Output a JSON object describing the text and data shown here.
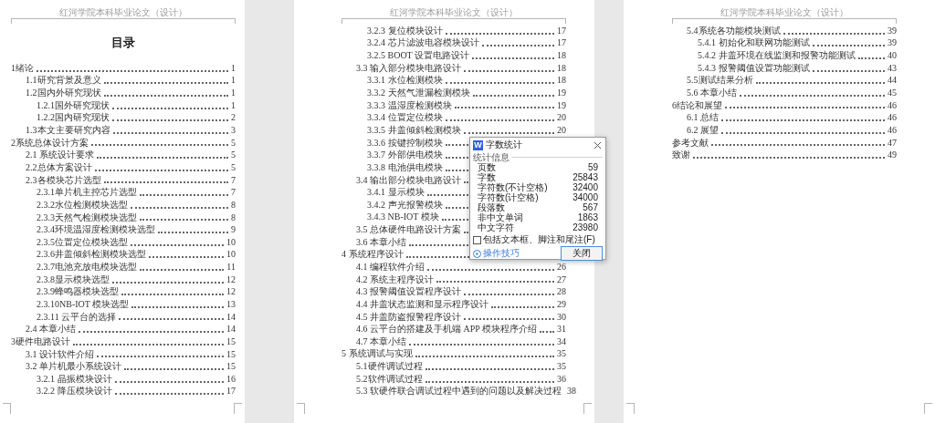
{
  "pages": [
    {
      "header": "红河学院本科毕业论文（设计）",
      "title": "目录",
      "entries": [
        {
          "kind": "chapter",
          "label": "1绪论",
          "page": "1"
        },
        {
          "kind": "section",
          "label": "1.1研究背景及意义",
          "page": "1"
        },
        {
          "kind": "section",
          "label": "1.2国内外研究现状",
          "page": "1"
        },
        {
          "kind": "subsection",
          "label": "1.2.1国外研究现状",
          "page": "1"
        },
        {
          "kind": "subsection",
          "label": "1.2.2国内研究现状",
          "page": "2"
        },
        {
          "kind": "section",
          "label": "1.3本文主要研究内容",
          "page": "3"
        },
        {
          "kind": "chapter",
          "label": "2系统总体设计方案",
          "page": "5"
        },
        {
          "kind": "section",
          "label": "2.1 系统设计要求",
          "page": "5"
        },
        {
          "kind": "section",
          "label": "2.2总体方案设计",
          "page": "5"
        },
        {
          "kind": "section",
          "label": "2.3各模块芯片选型",
          "page": "7"
        },
        {
          "kind": "subsection",
          "label": "2.3.1单片机主控芯片选型",
          "page": "7"
        },
        {
          "kind": "subsection",
          "label": "2.3.2水位检测模块选型",
          "page": "8"
        },
        {
          "kind": "subsection",
          "label": "2.3.3天然气检测模块选型",
          "page": "8"
        },
        {
          "kind": "subsection",
          "label": "2.3.4环境温湿度检测模块选型",
          "page": "9"
        },
        {
          "kind": "subsection",
          "label": "2.3.5位置定位模块选型",
          "page": "10"
        },
        {
          "kind": "subsection",
          "label": "2.3.6井盖倾斜检测模块选型",
          "page": "10"
        },
        {
          "kind": "subsection",
          "label": "2.3.7电池充放电模块选型",
          "page": "11"
        },
        {
          "kind": "subsection",
          "label": "2.3.8显示模块选型",
          "page": "12"
        },
        {
          "kind": "subsection",
          "label": "2.3.9蜂鸣器模块选型",
          "page": "12"
        },
        {
          "kind": "subsection",
          "label": "2.3.10NB-IOT 模块选型",
          "page": "13"
        },
        {
          "kind": "subsection",
          "label": "2.3.11 云平台的选择",
          "page": "14"
        },
        {
          "kind": "section",
          "label": "2.4 本章小结",
          "page": "14"
        },
        {
          "kind": "chapter",
          "label": "3硬件电路设计",
          "page": "15"
        },
        {
          "kind": "section",
          "label": "3.1 设计软件介绍",
          "page": "15"
        },
        {
          "kind": "section",
          "label": "3.2 单片机最小系统设计",
          "page": "15"
        },
        {
          "kind": "subsection",
          "label": "3.2.1 晶振模块设计",
          "page": "16"
        },
        {
          "kind": "subsection",
          "label": "3.2.2 降压模块设计",
          "page": "17"
        }
      ]
    },
    {
      "header": "红河学院本科毕业论文（设计）",
      "entries": [
        {
          "kind": "subsection",
          "label": "3.2.3 复位模块设计",
          "page": "17"
        },
        {
          "kind": "subsection",
          "label": "3.2.4 芯片滤波电容模块设计",
          "page": "17"
        },
        {
          "kind": "subsection",
          "label": "3.2.5 BOOT 设置电路设计",
          "page": "18"
        },
        {
          "kind": "section",
          "label": "3.3 输入部分模块电路设计",
          "page": "18"
        },
        {
          "kind": "subsection",
          "label": "3.3.1 水位检测模块",
          "page": "18"
        },
        {
          "kind": "subsection",
          "label": "3.3.2 天然气泄漏检测模块",
          "page": "19"
        },
        {
          "kind": "subsection",
          "label": "3.3.3 温湿度检测模块",
          "page": "19"
        },
        {
          "kind": "subsection",
          "label": "3.3.4 位置定位模块",
          "page": "20"
        },
        {
          "kind": "subsection",
          "label": "3.3.5 井盖倾斜检测模块",
          "page": "20"
        },
        {
          "kind": "subsection",
          "label": "3.3.6 按键控制模块"
        },
        {
          "kind": "subsection",
          "label": "3.3.7 外部供电模块"
        },
        {
          "kind": "subsection",
          "label": "3.3.8 电池供电模块"
        },
        {
          "kind": "section",
          "label": "3.4 输出部分模块电路设计"
        },
        {
          "kind": "subsection",
          "label": "3.4.1 显示模块"
        },
        {
          "kind": "subsection",
          "label": "3.4.2 声光报警模块"
        },
        {
          "kind": "subsection",
          "label": "3.4.3 NB-IOT 模块"
        },
        {
          "kind": "section",
          "label": "3.5 总体硬件电路设计方案"
        },
        {
          "kind": "section",
          "label": "3.6 本章小结"
        },
        {
          "kind": "chapter",
          "label": "4 系统程序设计"
        },
        {
          "kind": "section",
          "label": "4.1 编程软件介绍",
          "page": "26"
        },
        {
          "kind": "section",
          "label": "4.2 系统主程序设计",
          "page": "27"
        },
        {
          "kind": "section",
          "label": "4.3 报警阈值设置程序设计",
          "page": "28"
        },
        {
          "kind": "section",
          "label": "4.4 井盖状态监测和显示程序设计",
          "page": "29"
        },
        {
          "kind": "section",
          "label": "4.5 井盖防盗报警程序设计",
          "page": "30"
        },
        {
          "kind": "section",
          "label": "4.6 云平台的搭建及手机端 APP 模块程序介绍",
          "page": "31"
        },
        {
          "kind": "section",
          "label": "4.7 本章小结",
          "page": "34"
        },
        {
          "kind": "chapter",
          "label": "5 系统调试与实现",
          "page": "35"
        },
        {
          "kind": "section",
          "label": "5.1硬件调试过程",
          "page": "35"
        },
        {
          "kind": "section",
          "label": "5.2软件调试过程",
          "page": "36"
        },
        {
          "kind": "section",
          "label": "5.3 软硬件联合调试过程中遇到的问题以及解决过程",
          "page": "38"
        }
      ]
    },
    {
      "header": "红河学院本科毕业论文（设计）",
      "entries": [
        {
          "kind": "section",
          "label": "5.4系统各功能模块测试",
          "page": "39"
        },
        {
          "kind": "subsection",
          "label": "5.4.1 初始化和联网功能测试",
          "page": "39"
        },
        {
          "kind": "subsection",
          "label": "5.4.2 井盖环境在线监测和报警功能测试",
          "page": "40"
        },
        {
          "kind": "subsection",
          "label": "5.4.3 报警阈值设置功能测试",
          "page": "43"
        },
        {
          "kind": "section",
          "label": "5.5测试结果分析",
          "page": "44"
        },
        {
          "kind": "section",
          "label": "5.6 本章小结",
          "page": "45"
        },
        {
          "kind": "chapter",
          "label": "6结论和展望",
          "page": "46"
        },
        {
          "kind": "section",
          "label": "6.1 总结",
          "page": "46"
        },
        {
          "kind": "section",
          "label": "6.2 展望",
          "page": "46"
        },
        {
          "kind": "chapter",
          "label": "参考文献",
          "page": "47"
        },
        {
          "kind": "chapter",
          "label": "致谢",
          "page": "49"
        }
      ]
    }
  ],
  "dialog": {
    "app_icon_letter": "W",
    "title": "字数统计",
    "section": "统计信息",
    "stats": [
      {
        "label": "页数",
        "value": "59"
      },
      {
        "label": "字数",
        "value": "25843"
      },
      {
        "label": "字符数(不计空格)",
        "value": "32400"
      },
      {
        "label": "字符数(计空格)",
        "value": "34000"
      },
      {
        "label": "段落数",
        "value": "567"
      },
      {
        "label": "非中文单词",
        "value": "1863"
      },
      {
        "label": "中文字符",
        "value": "23980"
      }
    ],
    "include_option": {
      "label": "包括文本框、脚注和尾注(F)",
      "checked": false
    },
    "tips_link": "操作技巧",
    "close_button": "关闭"
  }
}
